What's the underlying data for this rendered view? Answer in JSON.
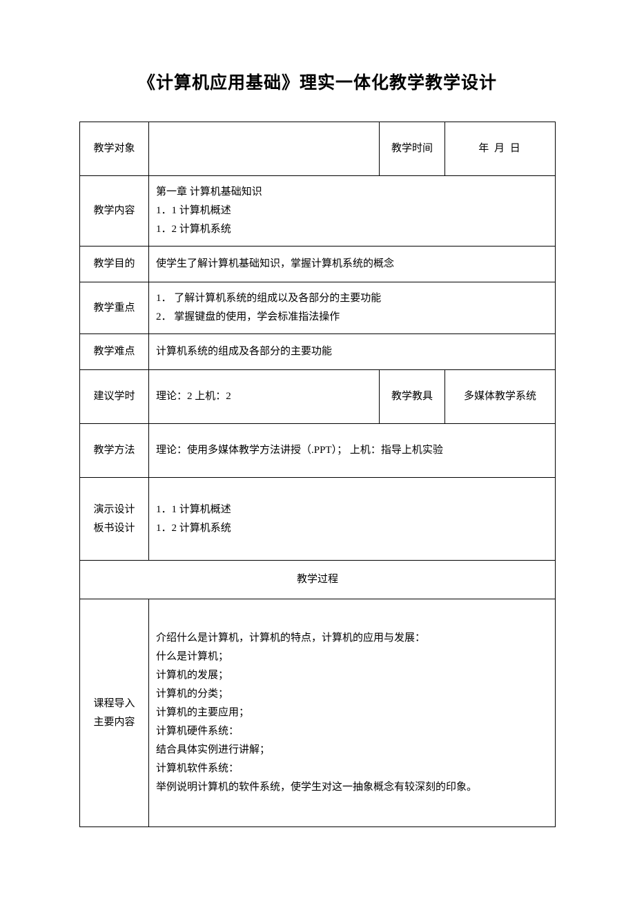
{
  "title": "《计算机应用基础》理实一体化教学教学设计",
  "rows": {
    "r1": {
      "label": "教学对象",
      "val": "",
      "midLabel": "教学时间",
      "right": "年   月    日"
    },
    "r2": {
      "label": "教学内容",
      "val": "第一章    计算机基础知识\n1．1    计算机概述\n1．2    计算机系统"
    },
    "r3": {
      "label": "教学目的",
      "val": "使学生了解计算机基础知识，掌握计算机系统的概念"
    },
    "r4": {
      "label": "教学重点",
      "val": "1．  了解计算机系统的组成以及各部分的主要功能\n2．  掌握键盘的使用，学会标准指法操作"
    },
    "r5": {
      "label": "教学难点",
      "val": "计算机系统的组成及各部分的主要功能"
    },
    "r6": {
      "label": "建议学时",
      "val": "理论：2       上机：2",
      "midLabel": "教学教具",
      "right": "多媒体教学系统"
    },
    "r7": {
      "label": "教学方法",
      "val": "理论：使用多媒体教学方法讲授（.PPT）；  上机：指导上机实验"
    },
    "r8": {
      "label": "演示设计\n板书设计",
      "val": "1．1    计算机概述\n1．2    计算机系统"
    },
    "r9": {
      "process": "教学过程"
    },
    "r10": {
      "label": "课程导入\n主要内容",
      "val": "介绍什么是计算机，计算机的特点，计算机的应用与发展：\n什么是计算机；\n计算机的发展；\n计算机的分类；\n计算机的主要应用；\n计算机硬件系统：\n结合具体实例进行讲解；\n计算机软件系统：\n举例说明计算机的软件系统，使学生对这一抽象概念有较深刻的印象。"
    }
  }
}
